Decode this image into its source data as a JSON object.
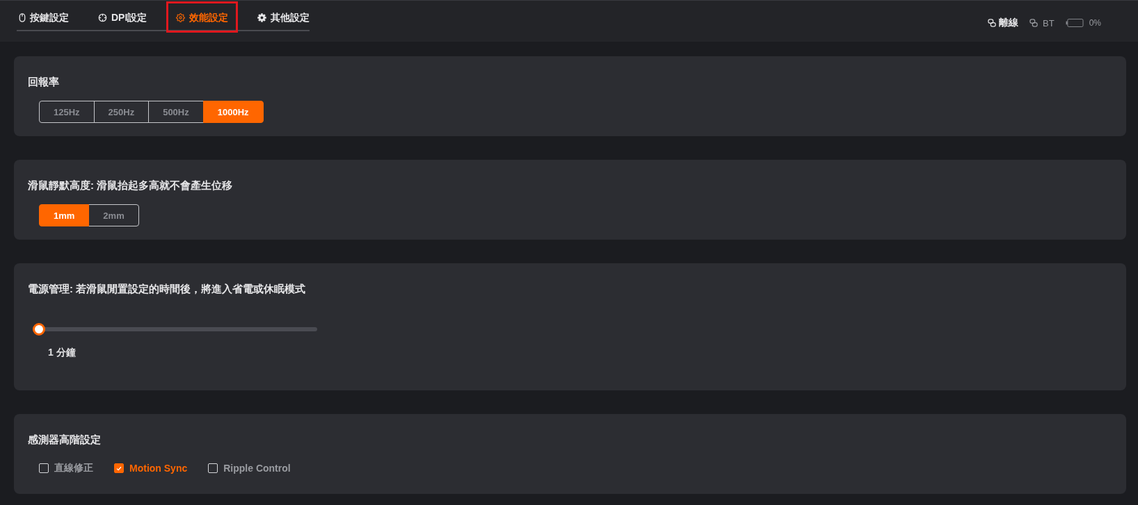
{
  "tabs": [
    {
      "label": "按鍵設定",
      "selected": false,
      "highlighted": false
    },
    {
      "label": "DPI設定",
      "selected": false,
      "highlighted": false
    },
    {
      "label": "效能設定",
      "selected": true,
      "highlighted": true
    },
    {
      "label": "其他設定",
      "selected": false,
      "highlighted": false
    }
  ],
  "status": {
    "connection": "離線",
    "bluetooth": "BT",
    "battery": "0%"
  },
  "sections": [
    {
      "kind": "segmented",
      "title": "回報率",
      "options": [
        {
          "label": "125Hz",
          "selected": false
        },
        {
          "label": "250Hz",
          "selected": false
        },
        {
          "label": "500Hz",
          "selected": false
        },
        {
          "label": "1000Hz",
          "selected": true
        }
      ]
    },
    {
      "kind": "segmented",
      "title": "滑鼠靜默高度: 滑鼠抬起多高就不會產生位移",
      "options": [
        {
          "label": "1mm",
          "selected": true
        },
        {
          "label": "2mm",
          "selected": false
        }
      ]
    },
    {
      "kind": "slider",
      "title": "電源管理: 若滑鼠閒置設定的時間後，將進入省電或休眠模式",
      "level": 0,
      "value": "1 分鐘"
    },
    {
      "kind": "checkboxes",
      "title": "感測器高階設定",
      "options": [
        {
          "label": "直線修正",
          "checked": false
        },
        {
          "label": "Motion Sync",
          "checked": true
        },
        {
          "label": "Ripple Control",
          "checked": false
        }
      ]
    }
  ]
}
